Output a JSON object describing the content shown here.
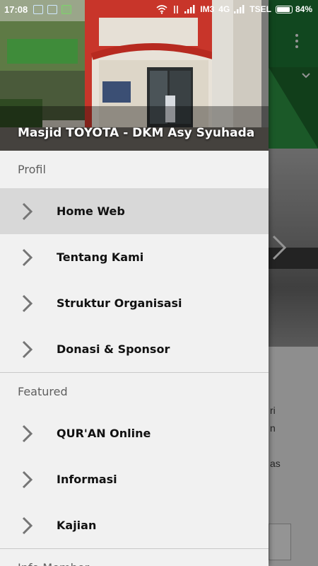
{
  "status_bar": {
    "time": "17:08",
    "carrier1": "IM3",
    "network": "4G",
    "carrier2": "TSEL",
    "battery_percent": "84%",
    "battery_level": 0.84,
    "left_icons": [
      "screenshot-icon",
      "bus-icon",
      "android-icon"
    ],
    "right_icons": [
      "wifi-icon",
      "data-transfer-icon",
      "signal-icon",
      "signal-icon",
      "battery-icon"
    ]
  },
  "drawer": {
    "header_title": "Masjid TOYOTA - DKM Asy Syuhada",
    "sections": [
      {
        "title": "Profil",
        "items": [
          {
            "label": "Home Web",
            "icon": "chevron-right-icon",
            "active": true
          },
          {
            "label": "Tentang Kami",
            "icon": "chevron-right-icon"
          },
          {
            "label": "Struktur Organisasi",
            "icon": "chevron-right-icon"
          },
          {
            "label": "Donasi & Sponsor",
            "icon": "chevron-right-icon"
          }
        ]
      },
      {
        "title": "Featured",
        "items": [
          {
            "label": "QUR'AN Online",
            "icon": "chevron-right-icon"
          },
          {
            "label": "Informasi",
            "icon": "chevron-right-icon"
          },
          {
            "label": "Kajian",
            "icon": "chevron-right-icon"
          }
        ]
      },
      {
        "title": "Info Member",
        "items": []
      }
    ]
  },
  "background": {
    "content_fragments": [
      "ri",
      "n",
      "as"
    ],
    "colors": {
      "toolbar": "#1e7b36",
      "accent_green": "#2f9a45",
      "scrim": "rgba(0,0,0,0.42)",
      "active_item": "#d8d8d8"
    }
  }
}
